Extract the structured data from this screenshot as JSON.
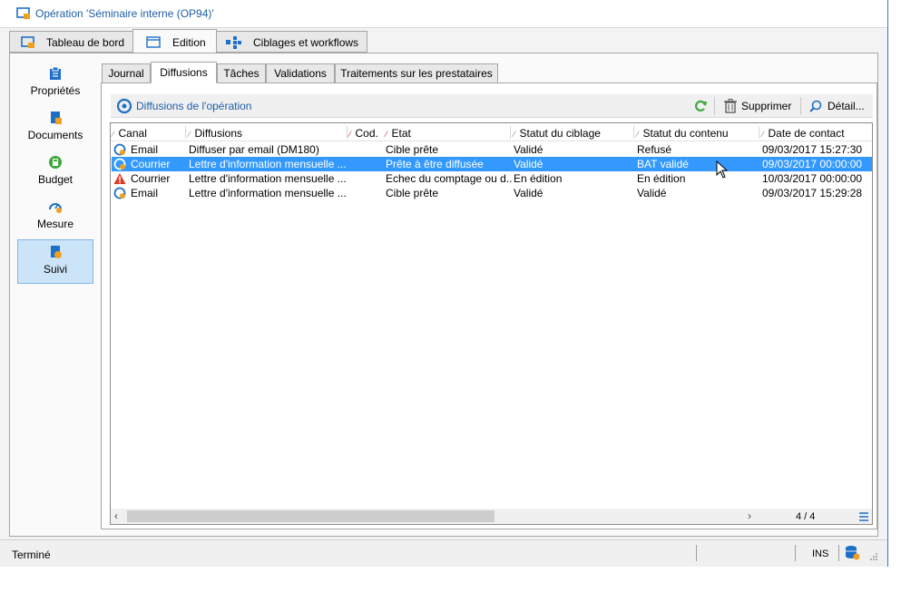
{
  "window": {
    "title": "Opération 'Séminaire interne (OP94)'"
  },
  "main_tabs": [
    {
      "label": "Tableau de bord"
    },
    {
      "label": "Edition"
    },
    {
      "label": "Ciblages et workflows"
    }
  ],
  "nav": [
    {
      "label": "Propriétés",
      "icon": "clipboard-icon"
    },
    {
      "label": "Documents",
      "icon": "documents-icon"
    },
    {
      "label": "Budget",
      "icon": "budget-icon"
    },
    {
      "label": "Mesure",
      "icon": "gauge-icon"
    },
    {
      "label": "Suivi",
      "icon": "tracking-icon"
    }
  ],
  "sub_tabs": [
    {
      "label": "Journal"
    },
    {
      "label": "Diffusions"
    },
    {
      "label": "Tâches"
    },
    {
      "label": "Validations"
    },
    {
      "label": "Traitements sur les prestataires"
    }
  ],
  "toolbar": {
    "title": "Diffusions de l'opération",
    "delete_label": "Supprimer",
    "detail_label": "Détail..."
  },
  "grid": {
    "columns": [
      "Canal",
      "Diffusions",
      "Cod.",
      "Etat",
      "Statut du ciblage",
      "Statut du contenu",
      "Date de contact"
    ],
    "rows": [
      {
        "icon": "delivery-icon",
        "canal": "Email",
        "diffusion": "Diffuser par email (DM180)",
        "code": "",
        "etat": "Cible prête",
        "ciblage": "Validé",
        "contenu": "Refusé",
        "date": "09/03/2017 15:27:30"
      },
      {
        "icon": "delivery-icon",
        "canal": "Courrier",
        "diffusion": "Lettre d'information mensuelle ...",
        "code": "",
        "etat": "Prête à être diffusée",
        "ciblage": "Validé",
        "contenu": "BAT validé",
        "date": "09/03/2017 00:00:00"
      },
      {
        "icon": "warning-icon",
        "canal": "Courrier",
        "diffusion": "Lettre d'information mensuelle ...",
        "code": "",
        "etat": "Echec du comptage ou d...",
        "ciblage": "En édition",
        "contenu": "En édition",
        "date": "10/03/2017 00:00:00"
      },
      {
        "icon": "delivery-icon",
        "canal": "Email",
        "diffusion": "Lettre d'information mensuelle ...",
        "code": "",
        "etat": "Cible prête",
        "ciblage": "Validé",
        "contenu": "Validé",
        "date": "09/03/2017 15:29:28"
      }
    ],
    "selected_row": 1,
    "page_count": "4 / 4"
  },
  "status": {
    "text": "Terminé",
    "mode": "INS"
  },
  "colors": {
    "accent": "#1e5fa8",
    "selection": "#3399ff",
    "nav_active": "#cce4f7"
  }
}
